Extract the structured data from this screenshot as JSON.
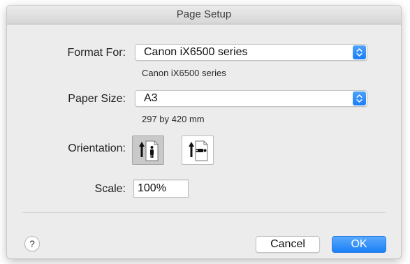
{
  "window": {
    "title": "Page Setup"
  },
  "format_for": {
    "label": "Format For:",
    "selected": "Canon iX6500 series",
    "description": "Canon iX6500 series"
  },
  "paper_size": {
    "label": "Paper Size:",
    "selected": "A3",
    "dimensions": "297 by 420 mm"
  },
  "orientation": {
    "label": "Orientation:",
    "options": [
      {
        "name": "portrait",
        "selected": true
      },
      {
        "name": "landscape",
        "selected": false
      }
    ]
  },
  "scale": {
    "label": "Scale:",
    "value": "100%"
  },
  "buttons": {
    "help": "?",
    "cancel": "Cancel",
    "ok": "OK"
  },
  "colors": {
    "accent": "#1a7ef6",
    "window_bg": "#ececec"
  },
  "icons": {
    "popup_stepper": "chevron-up-down-icon",
    "portrait": "portrait-orientation-icon",
    "landscape": "landscape-orientation-icon"
  }
}
